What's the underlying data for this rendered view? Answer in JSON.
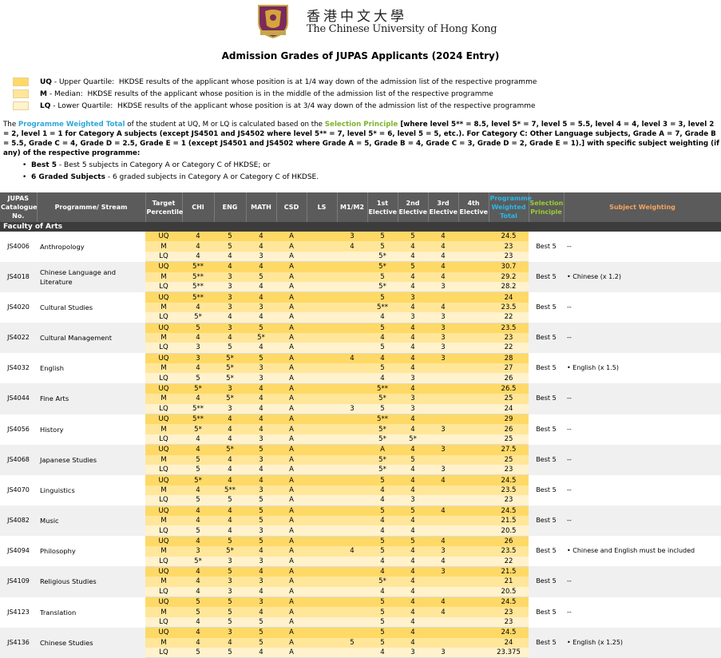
{
  "header": {
    "university_cn": "香港中文大學",
    "university_en": "The Chinese University of Hong Kong",
    "title": "Admission Grades of JUPAS Applicants (2024 Entry)"
  },
  "legend": [
    {
      "code": "UQ",
      "label": "Upper Quartile",
      "desc": "HKDSE results of the applicant whose position is at 1/4 way down of the admission list of the respective programme"
    },
    {
      "code": "M",
      "label": "Median",
      "desc": "HKDSE results of the applicant whose position is in the middle of the admission list of the respective programme"
    },
    {
      "code": "LQ",
      "label": "Lower Quartile",
      "desc": "HKDSE results of the applicant whose position is at 3/4 way down of the admission list of the respective programme"
    }
  ],
  "intro": {
    "p1": "The ",
    "pwt": "Programme Weighted Total",
    "p2": " of the student at UQ, M or LQ is calculated based on the ",
    "sp": "Selection Principle",
    "p3": " [where level 5** = 8.5, level 5* = 7, level 5 = 5.5, level 4 = 4, level 3 = 3, level 2 = 2, level 1 = 1 for Category A subjects (except JS4501 and JS4502 where level 5** = 7, level 5* = 6, level 5 = 5, etc.). For Category C: Other Language subjects, Grade A = 7, Grade B = 5.5, Grade C = 4, Grade D = 2.5, Grade E = 1 (except JS4501 and JS4502 where Grade A = 5, Grade B = 4, Grade C = 3, Grade D = 2, Grade E = 1).] with specific subject weighting (if any) of the respective programme:"
  },
  "bullets": [
    {
      "term": "Best 5",
      "desc": " -  Best 5 subjects in Category A or Category C of HKDSE; or"
    },
    {
      "term": "6 Graded Subjects",
      "desc": " - 6 graded subjects in Category A or Category C of HKDSE."
    }
  ],
  "table": {
    "headers": {
      "code": "JUPAS Catalogue No.",
      "prog": "Programme/ Stream",
      "target": "Target Percentile",
      "chi": "CHI",
      "eng": "ENG",
      "math": "MATH",
      "csd": "CSD",
      "ls": "LS",
      "m1m2": "M1/M2",
      "e1": "1st Elective",
      "e2": "2nd Elective",
      "e3": "3rd Elective",
      "e4": "4th Elective",
      "pwt": "Programme Weighted Total",
      "sel": "Selection Principle",
      "subw": "Subject Weighting"
    },
    "faculty": "Faculty of Arts",
    "programmes": [
      {
        "code": "JS4006",
        "name": "Anthropology",
        "sel": "Best 5",
        "weighting": "--",
        "rows": [
          {
            "p": "UQ",
            "chi": "4",
            "eng": "5",
            "math": "4",
            "csd": "A",
            "ls": "",
            "m": "3",
            "e1": "5",
            "e2": "5",
            "e3": "4",
            "e4": "",
            "t": "24.5"
          },
          {
            "p": "M",
            "chi": "4",
            "eng": "5",
            "math": "4",
            "csd": "A",
            "ls": "",
            "m": "4",
            "e1": "5",
            "e2": "4",
            "e3": "4",
            "e4": "",
            "t": "23"
          },
          {
            "p": "LQ",
            "chi": "4",
            "eng": "4",
            "math": "3",
            "csd": "A",
            "ls": "",
            "m": "",
            "e1": "5*",
            "e2": "4",
            "e3": "4",
            "e4": "",
            "t": "23"
          }
        ]
      },
      {
        "code": "JS4018",
        "name": "Chinese Language and Literature",
        "sel": "Best 5",
        "weighting": "• Chinese (x 1.2)",
        "rows": [
          {
            "p": "UQ",
            "chi": "5**",
            "eng": "4",
            "math": "4",
            "csd": "A",
            "ls": "",
            "m": "",
            "e1": "5*",
            "e2": "5",
            "e3": "4",
            "e4": "",
            "t": "30.7"
          },
          {
            "p": "M",
            "chi": "5**",
            "eng": "3",
            "math": "5",
            "csd": "A",
            "ls": "",
            "m": "",
            "e1": "5",
            "e2": "4",
            "e3": "4",
            "e4": "",
            "t": "29.2"
          },
          {
            "p": "LQ",
            "chi": "5**",
            "eng": "3",
            "math": "4",
            "csd": "A",
            "ls": "",
            "m": "",
            "e1": "5*",
            "e2": "4",
            "e3": "3",
            "e4": "",
            "t": "28.2"
          }
        ]
      },
      {
        "code": "JS4020",
        "name": "Cultural Studies",
        "sel": "Best 5",
        "weighting": "--",
        "rows": [
          {
            "p": "UQ",
            "chi": "5**",
            "eng": "3",
            "math": "4",
            "csd": "A",
            "ls": "",
            "m": "",
            "e1": "5",
            "e2": "3",
            "e3": "",
            "e4": "",
            "t": "24"
          },
          {
            "p": "M",
            "chi": "4",
            "eng": "3",
            "math": "3",
            "csd": "A",
            "ls": "",
            "m": "",
            "e1": "5**",
            "e2": "4",
            "e3": "4",
            "e4": "",
            "t": "23.5"
          },
          {
            "p": "LQ",
            "chi": "5*",
            "eng": "4",
            "math": "4",
            "csd": "A",
            "ls": "",
            "m": "",
            "e1": "4",
            "e2": "3",
            "e3": "3",
            "e4": "",
            "t": "22"
          }
        ]
      },
      {
        "code": "JS4022",
        "name": "Cultural Management",
        "sel": "Best 5",
        "weighting": "--",
        "rows": [
          {
            "p": "UQ",
            "chi": "5",
            "eng": "3",
            "math": "5",
            "csd": "A",
            "ls": "",
            "m": "",
            "e1": "5",
            "e2": "4",
            "e3": "3",
            "e4": "",
            "t": "23.5"
          },
          {
            "p": "M",
            "chi": "4",
            "eng": "4",
            "math": "5*",
            "csd": "A",
            "ls": "",
            "m": "",
            "e1": "4",
            "e2": "4",
            "e3": "3",
            "e4": "",
            "t": "23"
          },
          {
            "p": "LQ",
            "chi": "3",
            "eng": "5",
            "math": "4",
            "csd": "A",
            "ls": "",
            "m": "",
            "e1": "5",
            "e2": "4",
            "e3": "3",
            "e4": "",
            "t": "22"
          }
        ]
      },
      {
        "code": "JS4032",
        "name": "English",
        "sel": "Best 5",
        "weighting": "• English (x 1.5)",
        "rows": [
          {
            "p": "UQ",
            "chi": "3",
            "eng": "5*",
            "math": "5",
            "csd": "A",
            "ls": "",
            "m": "4",
            "e1": "4",
            "e2": "4",
            "e3": "3",
            "e4": "",
            "t": "28"
          },
          {
            "p": "M",
            "chi": "4",
            "eng": "5*",
            "math": "3",
            "csd": "A",
            "ls": "",
            "m": "",
            "e1": "5",
            "e2": "4",
            "e3": "",
            "e4": "",
            "t": "27"
          },
          {
            "p": "LQ",
            "chi": "5",
            "eng": "5*",
            "math": "3",
            "csd": "A",
            "ls": "",
            "m": "",
            "e1": "4",
            "e2": "3",
            "e3": "",
            "e4": "",
            "t": "26"
          }
        ]
      },
      {
        "code": "JS4044",
        "name": "Fine Arts",
        "sel": "Best 5",
        "weighting": "--",
        "rows": [
          {
            "p": "UQ",
            "chi": "5*",
            "eng": "3",
            "math": "4",
            "csd": "A",
            "ls": "",
            "m": "",
            "e1": "5**",
            "e2": "4",
            "e3": "",
            "e4": "",
            "t": "26.5"
          },
          {
            "p": "M",
            "chi": "4",
            "eng": "5*",
            "math": "4",
            "csd": "A",
            "ls": "",
            "m": "",
            "e1": "5*",
            "e2": "3",
            "e3": "",
            "e4": "",
            "t": "25"
          },
          {
            "p": "LQ",
            "chi": "5**",
            "eng": "3",
            "math": "4",
            "csd": "A",
            "ls": "",
            "m": "3",
            "e1": "5",
            "e2": "3",
            "e3": "",
            "e4": "",
            "t": "24"
          }
        ]
      },
      {
        "code": "JS4056",
        "name": "History",
        "sel": "Best 5",
        "weighting": "--",
        "rows": [
          {
            "p": "UQ",
            "chi": "5**",
            "eng": "4",
            "math": "4",
            "csd": "A",
            "ls": "",
            "m": "",
            "e1": "5**",
            "e2": "4",
            "e3": "",
            "e4": "",
            "t": "29"
          },
          {
            "p": "M",
            "chi": "5*",
            "eng": "4",
            "math": "4",
            "csd": "A",
            "ls": "",
            "m": "",
            "e1": "5*",
            "e2": "4",
            "e3": "3",
            "e4": "",
            "t": "26"
          },
          {
            "p": "LQ",
            "chi": "4",
            "eng": "4",
            "math": "3",
            "csd": "A",
            "ls": "",
            "m": "",
            "e1": "5*",
            "e2": "5*",
            "e3": "",
            "e4": "",
            "t": "25"
          }
        ]
      },
      {
        "code": "JS4068",
        "name": "Japanese Studies",
        "sel": "Best 5",
        "weighting": "--",
        "rows": [
          {
            "p": "UQ",
            "chi": "4",
            "eng": "5*",
            "math": "5",
            "csd": "A",
            "ls": "",
            "m": "",
            "e1": "A",
            "e2": "4",
            "e3": "3",
            "e4": "",
            "t": "27.5"
          },
          {
            "p": "M",
            "chi": "5",
            "eng": "4",
            "math": "3",
            "csd": "A",
            "ls": "",
            "m": "",
            "e1": "5*",
            "e2": "5",
            "e3": "",
            "e4": "",
            "t": "25"
          },
          {
            "p": "LQ",
            "chi": "5",
            "eng": "4",
            "math": "4",
            "csd": "A",
            "ls": "",
            "m": "",
            "e1": "5*",
            "e2": "4",
            "e3": "3",
            "e4": "",
            "t": "23"
          }
        ]
      },
      {
        "code": "JS4070",
        "name": "Linguistics",
        "sel": "Best 5",
        "weighting": "--",
        "rows": [
          {
            "p": "UQ",
            "chi": "5*",
            "eng": "4",
            "math": "4",
            "csd": "A",
            "ls": "",
            "m": "",
            "e1": "5",
            "e2": "4",
            "e3": "4",
            "e4": "",
            "t": "24.5"
          },
          {
            "p": "M",
            "chi": "4",
            "eng": "5**",
            "math": "3",
            "csd": "A",
            "ls": "",
            "m": "",
            "e1": "4",
            "e2": "4",
            "e3": "",
            "e4": "",
            "t": "23.5"
          },
          {
            "p": "LQ",
            "chi": "5",
            "eng": "5",
            "math": "5",
            "csd": "A",
            "ls": "",
            "m": "",
            "e1": "4",
            "e2": "3",
            "e3": "",
            "e4": "",
            "t": "23"
          }
        ]
      },
      {
        "code": "JS4082",
        "name": "Music",
        "sel": "Best 5",
        "weighting": "--",
        "rows": [
          {
            "p": "UQ",
            "chi": "4",
            "eng": "4",
            "math": "5",
            "csd": "A",
            "ls": "",
            "m": "",
            "e1": "5",
            "e2": "5",
            "e3": "4",
            "e4": "",
            "t": "24.5"
          },
          {
            "p": "M",
            "chi": "4",
            "eng": "4",
            "math": "5",
            "csd": "A",
            "ls": "",
            "m": "",
            "e1": "4",
            "e2": "4",
            "e3": "",
            "e4": "",
            "t": "21.5"
          },
          {
            "p": "LQ",
            "chi": "5",
            "eng": "4",
            "math": "3",
            "csd": "A",
            "ls": "",
            "m": "",
            "e1": "4",
            "e2": "4",
            "e3": "",
            "e4": "",
            "t": "20.5"
          }
        ]
      },
      {
        "code": "JS4094",
        "name": "Philosophy",
        "sel": "Best 5",
        "weighting": "• Chinese and English must be included",
        "rows": [
          {
            "p": "UQ",
            "chi": "4",
            "eng": "5",
            "math": "5",
            "csd": "A",
            "ls": "",
            "m": "",
            "e1": "5",
            "e2": "5",
            "e3": "4",
            "e4": "",
            "t": "26"
          },
          {
            "p": "M",
            "chi": "3",
            "eng": "5*",
            "math": "4",
            "csd": "A",
            "ls": "",
            "m": "4",
            "e1": "5",
            "e2": "4",
            "e3": "3",
            "e4": "",
            "t": "23.5"
          },
          {
            "p": "LQ",
            "chi": "5*",
            "eng": "3",
            "math": "3",
            "csd": "A",
            "ls": "",
            "m": "",
            "e1": "4",
            "e2": "4",
            "e3": "4",
            "e4": "",
            "t": "22"
          }
        ]
      },
      {
        "code": "JS4109",
        "name": "Religious Studies",
        "sel": "Best 5",
        "weighting": "--",
        "rows": [
          {
            "p": "UQ",
            "chi": "4",
            "eng": "5",
            "math": "4",
            "csd": "A",
            "ls": "",
            "m": "",
            "e1": "4",
            "e2": "4",
            "e3": "3",
            "e4": "",
            "t": "21.5"
          },
          {
            "p": "M",
            "chi": "4",
            "eng": "3",
            "math": "3",
            "csd": "A",
            "ls": "",
            "m": "",
            "e1": "5*",
            "e2": "4",
            "e3": "",
            "e4": "",
            "t": "21"
          },
          {
            "p": "LQ",
            "chi": "4",
            "eng": "3",
            "math": "4",
            "csd": "A",
            "ls": "",
            "m": "",
            "e1": "4",
            "e2": "4",
            "e3": "",
            "e4": "",
            "t": "20.5"
          }
        ]
      },
      {
        "code": "JS4123",
        "name": "Translation",
        "sel": "Best 5",
        "weighting": "--",
        "rows": [
          {
            "p": "UQ",
            "chi": "5",
            "eng": "5",
            "math": "3",
            "csd": "A",
            "ls": "",
            "m": "",
            "e1": "5",
            "e2": "4",
            "e3": "4",
            "e4": "",
            "t": "24.5"
          },
          {
            "p": "M",
            "chi": "5",
            "eng": "5",
            "math": "4",
            "csd": "A",
            "ls": "",
            "m": "",
            "e1": "5",
            "e2": "4",
            "e3": "4",
            "e4": "",
            "t": "23"
          },
          {
            "p": "LQ",
            "chi": "4",
            "eng": "5",
            "math": "5",
            "csd": "A",
            "ls": "",
            "m": "",
            "e1": "5",
            "e2": "4",
            "e3": "",
            "e4": "",
            "t": "23"
          }
        ]
      },
      {
        "code": "JS4136",
        "name": "Chinese Studies",
        "sel": "Best 5",
        "weighting": "• English (x 1.25)",
        "rows": [
          {
            "p": "UQ",
            "chi": "4",
            "eng": "3",
            "math": "5",
            "csd": "A",
            "ls": "",
            "m": "",
            "e1": "5",
            "e2": "4",
            "e3": "",
            "e4": "",
            "t": "24.5"
          },
          {
            "p": "M",
            "chi": "4",
            "eng": "4",
            "math": "5",
            "csd": "A",
            "ls": "",
            "m": "5",
            "e1": "5",
            "e2": "4",
            "e3": "",
            "e4": "",
            "t": "24"
          },
          {
            "p": "LQ",
            "chi": "5",
            "eng": "5",
            "math": "4",
            "csd": "A",
            "ls": "",
            "m": "",
            "e1": "4",
            "e2": "3",
            "e3": "3",
            "e4": "",
            "t": "23.375"
          }
        ]
      }
    ]
  }
}
